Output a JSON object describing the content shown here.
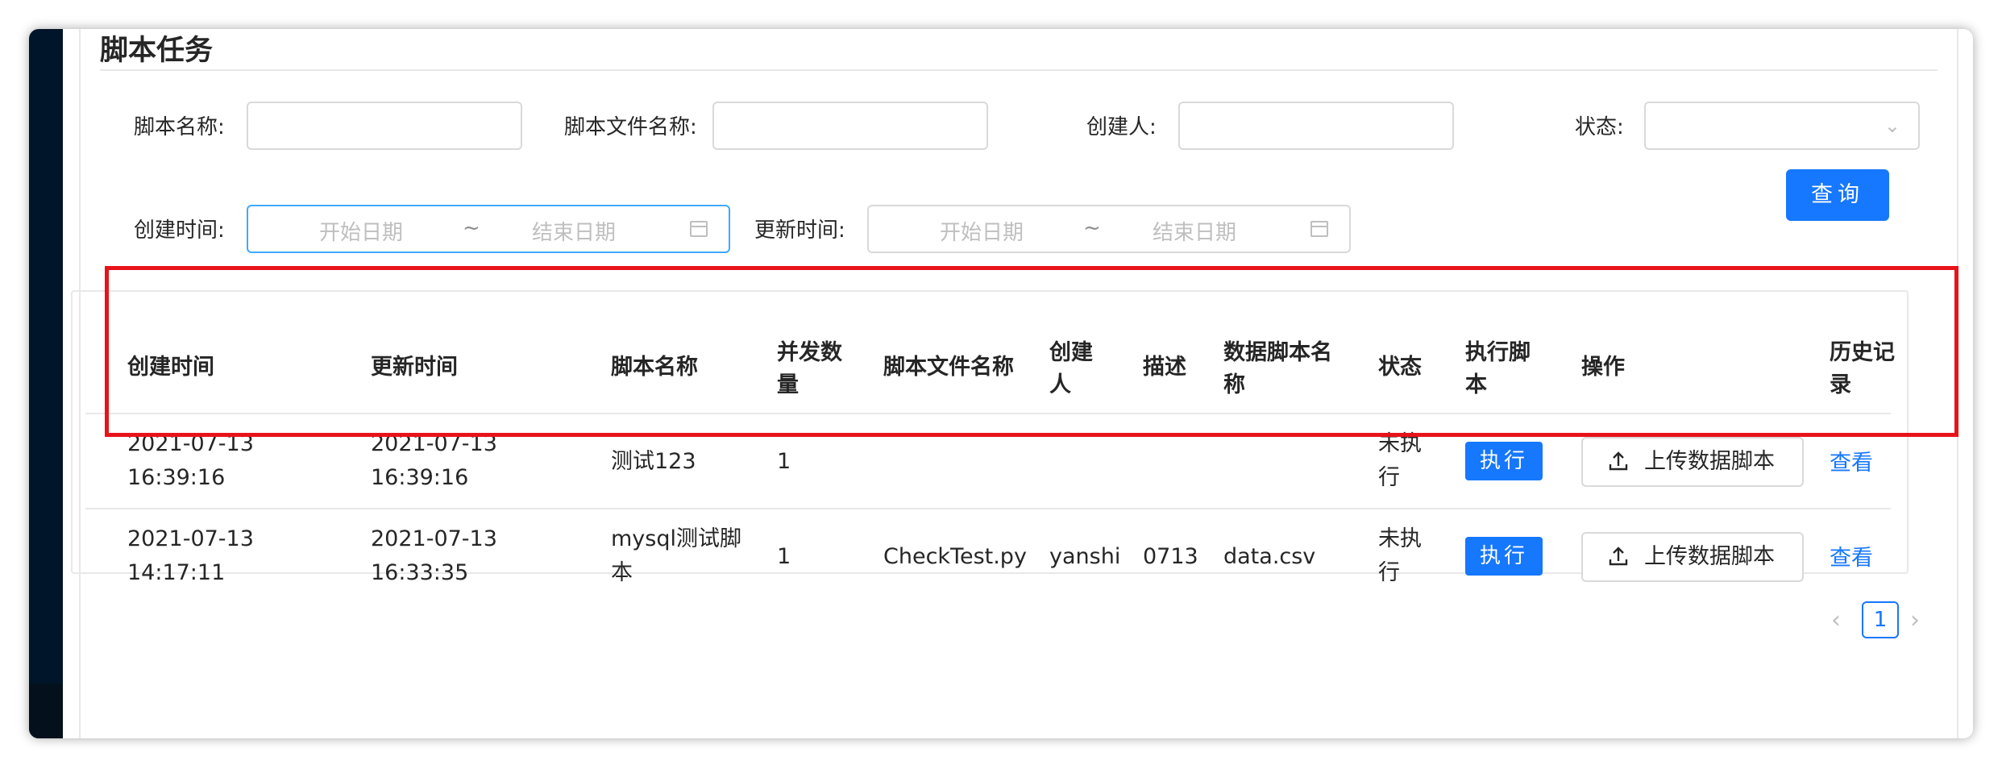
{
  "page": {
    "title": "脚本任务"
  },
  "filters": {
    "script_name_label": "脚本名称:",
    "file_name_label": "脚本文件名称:",
    "creator_label": "创建人:",
    "status_label": "状态:",
    "create_time_label": "创建时间:",
    "update_time_label": "更新时间:",
    "start_placeholder": "开始日期",
    "end_placeholder": "结束日期",
    "range_sep": "~",
    "query_button": "查询"
  },
  "table": {
    "headers": {
      "create_time": "创建时间",
      "update_time": "更新时间",
      "script_name": "脚本名称",
      "concurrency_1": "并发数",
      "concurrency_2": "量",
      "file_name": "脚本文件名称",
      "creator_1": "创建",
      "creator_2": "人",
      "description": "描述",
      "data_script_1": "数据脚本名",
      "data_script_2": "称",
      "status": "状态",
      "execute_1": "执行脚",
      "execute_2": "本",
      "operation": "操作",
      "history_1": "历史记",
      "history_2": "录"
    },
    "rows": [
      {
        "create_date": "2021-07-13",
        "create_clock": "16:39:16",
        "update_date": "2021-07-13",
        "update_clock": "16:39:16",
        "name_1": "测试123",
        "name_2": "",
        "concurrency": "1",
        "file_name": "",
        "creator": "",
        "description": "",
        "data_script": "",
        "status_1": "未执",
        "status_2": "行",
        "execute_button": "执行",
        "upload_button": "上传数据脚本",
        "history_link": "查看"
      },
      {
        "create_date": "2021-07-13",
        "create_clock": "14:17:11",
        "update_date": "2021-07-13",
        "update_clock": "16:33:35",
        "name_1": "mysql测试脚",
        "name_2": "本",
        "concurrency": "1",
        "file_name": "CheckTest.py",
        "creator": "yanshi",
        "description": "0713",
        "data_script": "data.csv",
        "status_1": "未执",
        "status_2": "行",
        "execute_button": "执行",
        "upload_button": "上传数据脚本",
        "history_link": "查看"
      }
    ]
  },
  "pagination": {
    "current": "1",
    "prev_icon": "left-chevron",
    "next_icon": "right-chevron"
  },
  "colors": {
    "primary": "#1677ff",
    "highlight": "#e8131a",
    "sidebar": "#001529"
  }
}
